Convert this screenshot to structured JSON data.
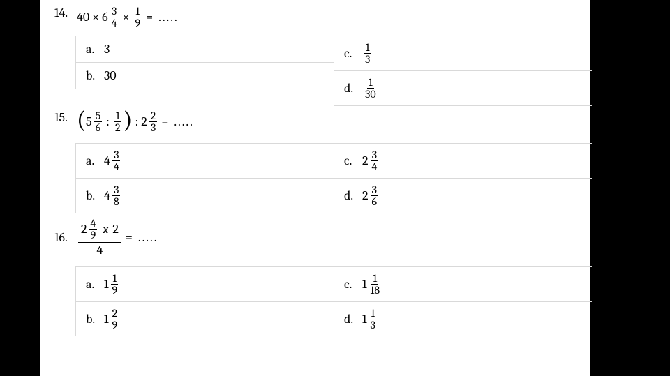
{
  "q14": {
    "num": "14.",
    "lhs": {
      "a": "40",
      "op1": "×",
      "m1_whole": "6",
      "m1_n": "3",
      "m1_d": "4",
      "op2": "×",
      "f2_n": "1",
      "f2_d": "9",
      "eq": "=",
      "dots": "....."
    },
    "opts": {
      "a_label": "a.",
      "a_val": "3",
      "b_label": "b.",
      "b_val": "30",
      "c_label": "c.",
      "c_fn": "1",
      "c_fd": "3",
      "d_label": "d.",
      "d_fn": "1",
      "d_fd": "30"
    }
  },
  "q15": {
    "num": "15.",
    "lp": "(",
    "m1_whole": "5",
    "m1_n": "5",
    "m1_d": "6",
    "colon1": ":",
    "f2_n": "1",
    "f2_d": "2",
    "rp": ")",
    "colon2": ":",
    "m3_whole": "2",
    "m3_n": "2",
    "m3_d": "3",
    "eq": "=",
    "dots": ".....",
    "opts": {
      "a_label": "a.",
      "a_whole": "4",
      "a_n": "3",
      "a_d": "4",
      "b_label": "b.",
      "b_whole": "4",
      "b_n": "3",
      "b_d": "8",
      "c_label": "c.",
      "c_whole": "2",
      "c_n": "3",
      "c_d": "4",
      "d_label": "d.",
      "d_whole": "2",
      "d_n": "3",
      "d_d": "6"
    }
  },
  "q16": {
    "num": "16.",
    "top_mwhole": "2",
    "top_mn": "4",
    "top_md": "9",
    "top_x": "x",
    "top_b": "2",
    "bot": "4",
    "eq": "=",
    "dots": ".....",
    "opts": {
      "a_label": "a.",
      "a_whole": "1",
      "a_n": "1",
      "a_d": "9",
      "b_label": "b.",
      "b_whole": "1",
      "b_n": "2",
      "b_d": "9",
      "c_label": "c.",
      "c_whole": "1",
      "c_n": "1",
      "c_d": "18",
      "d_label": "d.",
      "d_whole": "1",
      "d_n": "1",
      "d_d": "3"
    }
  },
  "chart_data": {
    "type": "table",
    "description": "Three multiple-choice math problems on fraction arithmetic (numbers 14-16), each with four answer options a-d arranged in a 2×2 grid.",
    "problems": [
      {
        "id": 14,
        "expression": "40 × 6 3/4 × 1/9 = …",
        "options": {
          "a": "3",
          "b": "30",
          "c": "1/3",
          "d": "1/30"
        }
      },
      {
        "id": 15,
        "expression": "(5 5/6 : 1/2) : 2 2/3 = …",
        "options": {
          "a": "4 3/4",
          "b": "4 3/8",
          "c": "2 3/4",
          "d": "2 3/6"
        }
      },
      {
        "id": 16,
        "expression": "(2 4/9 × 2) / 4 = …",
        "options": {
          "a": "1 1/9",
          "b": "1 2/9",
          "c": "1 1/18",
          "d": "1 1/3"
        }
      }
    ]
  }
}
